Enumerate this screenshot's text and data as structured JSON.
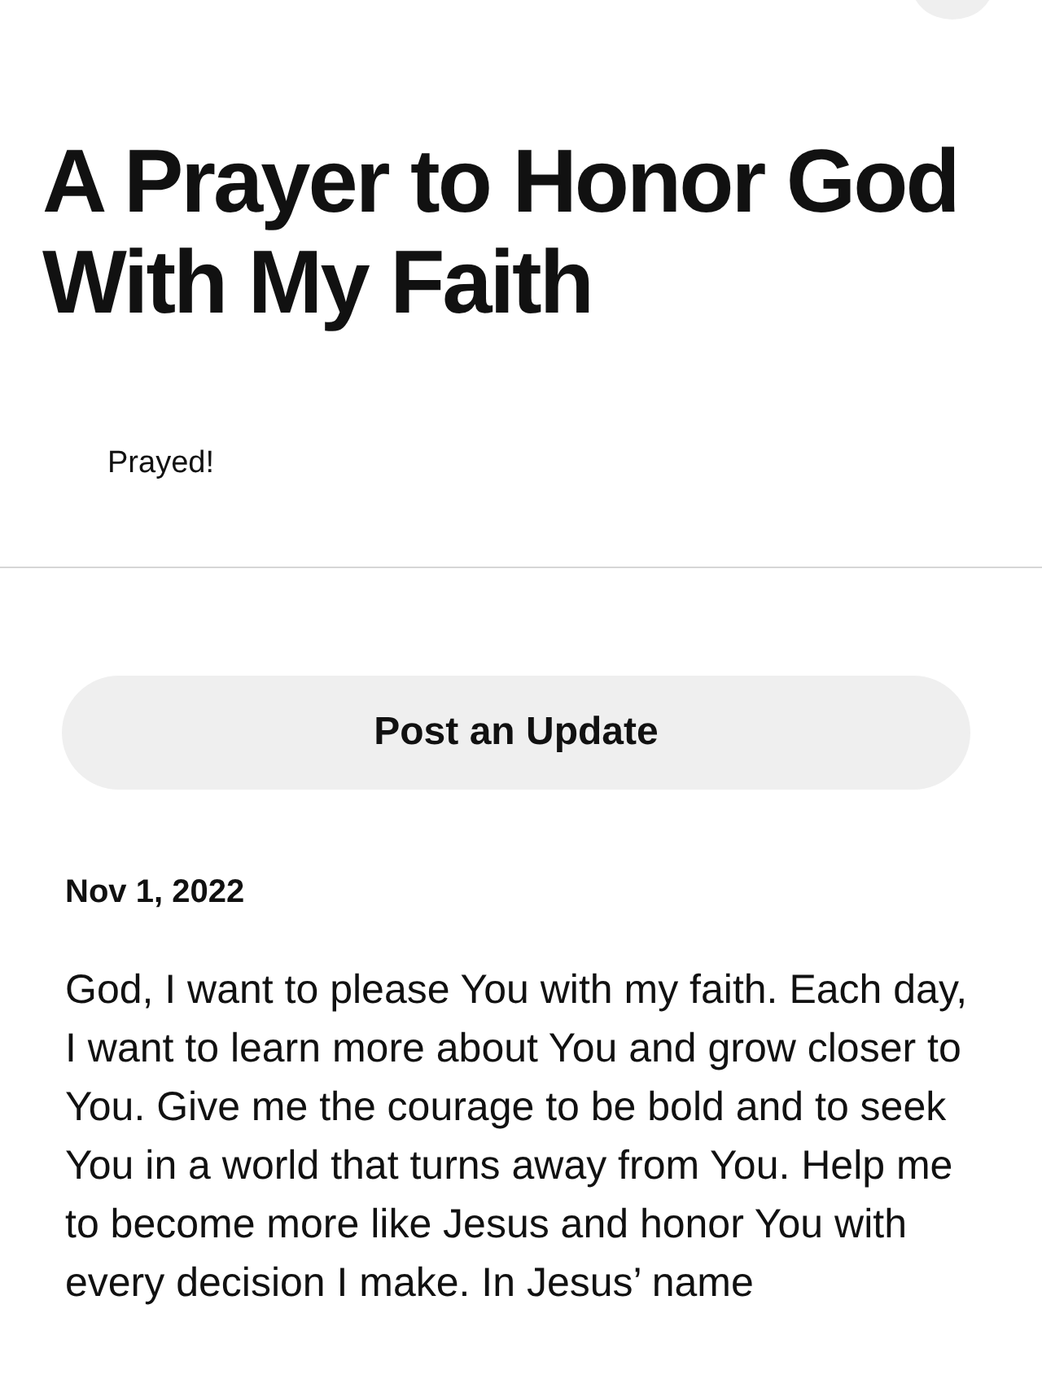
{
  "title": "A Prayer to Honor God With My Faith",
  "status": "Prayed!",
  "post_button": "Post an Update",
  "update": {
    "date": "Nov 1, 2022",
    "text": "God, I want to please You with my faith. Each day, I want to learn more about You and grow closer to You. Give me the courage to be bold and to seek You in a world that turns away from You. Help me to become more like Jesus and honor You with every decision I make. In Jesus’ name"
  }
}
